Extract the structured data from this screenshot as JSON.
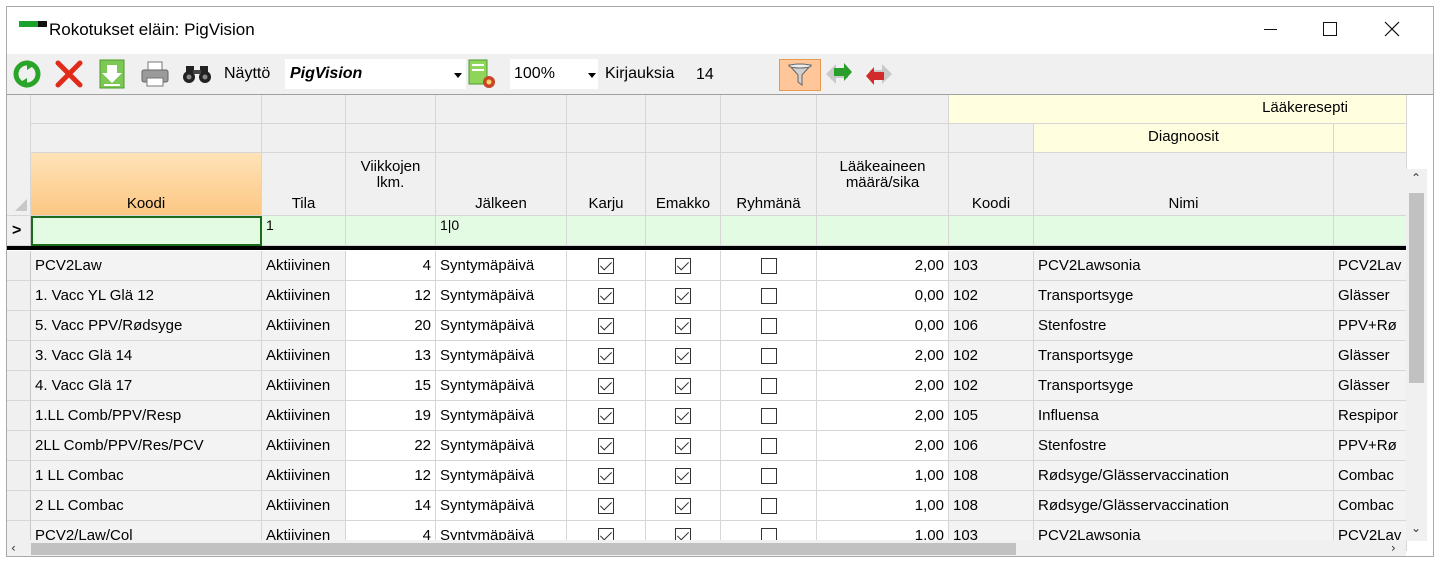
{
  "window": {
    "title": "Rokotukset eläin: PigVision"
  },
  "toolbar": {
    "display_label": "Näyttö",
    "display_value": "PigVision",
    "zoom_value": "100%",
    "records_label": "Kirjauksia",
    "records_value": "14",
    "icons": [
      "refresh-icon",
      "delete-icon",
      "download-icon",
      "print-icon",
      "binoculars-icon",
      "settings-icon",
      "filter-icon",
      "arrow-next-icon",
      "arrow-prev-icon"
    ]
  },
  "grid": {
    "band_top": "Lääkeresepti",
    "band_sub": "Diagnoosit",
    "columns": [
      "Koodi",
      "Tila",
      "Viikkojen lkm.",
      "Jälkeen",
      "Karju",
      "Emakko",
      "Ryhmänä",
      "Lääkeaineen määrä/sika",
      "Koodi",
      "Nimi",
      ""
    ],
    "filter_row": {
      "koodi": "",
      "tila": "1",
      "jalkeen": "1|0"
    },
    "rows": [
      {
        "koodi": "PCV2Law",
        "tila": "Aktiivinen",
        "viikot": "4",
        "jalkeen": "Syntymäpäivä",
        "karju": true,
        "emakko": true,
        "ryhmana": false,
        "maara": "2,00",
        "dkoodi": "103",
        "nimi": "PCV2Lawsonia",
        "extra": "PCV2Lav"
      },
      {
        "koodi": "1. Vacc YL Glä 12",
        "tila": "Aktiivinen",
        "viikot": "12",
        "jalkeen": "Syntymäpäivä",
        "karju": true,
        "emakko": true,
        "ryhmana": false,
        "maara": "0,00",
        "dkoodi": "102",
        "nimi": "Transportsyge",
        "extra": "Glässer"
      },
      {
        "koodi": "5. Vacc PPV/Rødsyge",
        "tila": "Aktiivinen",
        "viikot": "20",
        "jalkeen": "Syntymäpäivä",
        "karju": true,
        "emakko": true,
        "ryhmana": false,
        "maara": "0,00",
        "dkoodi": "106",
        "nimi": "Stenfostre",
        "extra": "PPV+Rø"
      },
      {
        "koodi": "3. Vacc Glä 14",
        "tila": "Aktiivinen",
        "viikot": "13",
        "jalkeen": "Syntymäpäivä",
        "karju": true,
        "emakko": true,
        "ryhmana": false,
        "maara": "2,00",
        "dkoodi": "102",
        "nimi": "Transportsyge",
        "extra": "Glässer"
      },
      {
        "koodi": "4. Vacc Glä 17",
        "tila": "Aktiivinen",
        "viikot": "15",
        "jalkeen": "Syntymäpäivä",
        "karju": true,
        "emakko": true,
        "ryhmana": false,
        "maara": "2,00",
        "dkoodi": "102",
        "nimi": "Transportsyge",
        "extra": "Glässer"
      },
      {
        "koodi": "1.LL Comb/PPV/Resp",
        "tila": "Aktiivinen",
        "viikot": "19",
        "jalkeen": "Syntymäpäivä",
        "karju": true,
        "emakko": true,
        "ryhmana": false,
        "maara": "2,00",
        "dkoodi": "105",
        "nimi": "Influensa",
        "extra": "Respipor"
      },
      {
        "koodi": "2LL Comb/PPV/Res/PCV",
        "tila": "Aktiivinen",
        "viikot": "22",
        "jalkeen": "Syntymäpäivä",
        "karju": true,
        "emakko": true,
        "ryhmana": false,
        "maara": "2,00",
        "dkoodi": "106",
        "nimi": "Stenfostre",
        "extra": "PPV+Rø"
      },
      {
        "koodi": "1 LL Combac",
        "tila": "Aktiivinen",
        "viikot": "12",
        "jalkeen": "Syntymäpäivä",
        "karju": true,
        "emakko": true,
        "ryhmana": false,
        "maara": "1,00",
        "dkoodi": "108",
        "nimi": "Rødsyge/Glässervaccination",
        "extra": "Combac"
      },
      {
        "koodi": "2 LL Combac",
        "tila": "Aktiivinen",
        "viikot": "14",
        "jalkeen": "Syntymäpäivä",
        "karju": true,
        "emakko": true,
        "ryhmana": false,
        "maara": "1,00",
        "dkoodi": "108",
        "nimi": "Rødsyge/Glässervaccination",
        "extra": "Combac"
      },
      {
        "koodi": "PCV2/Law/Col",
        "tila": "Aktiivinen",
        "viikot": "4",
        "jalkeen": "Syntymäpäivä",
        "karju": true,
        "emakko": true,
        "ryhmana": false,
        "maara": "1,00",
        "dkoodi": "103",
        "nimi": "PCV2Lawsonia",
        "extra": "PCV2Lav"
      }
    ]
  },
  "colors": {
    "sort_header": "#fcc783",
    "band": "#ffffe0",
    "filter_row": "#e2fbe2",
    "filter_button": "#ffc69a"
  }
}
